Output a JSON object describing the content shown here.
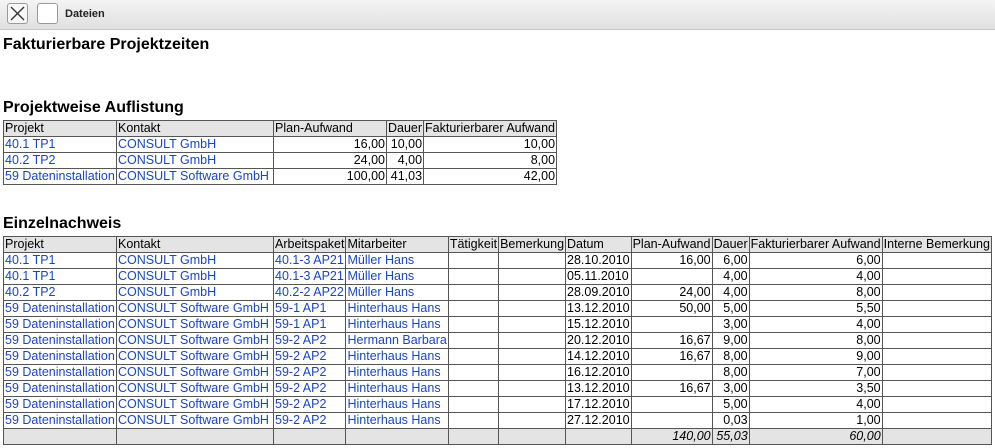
{
  "toolbar": {
    "close_icon": "close-icon",
    "title": "Dateien"
  },
  "page": {
    "title": "Fakturierbare Projektzeiten"
  },
  "projects": {
    "heading": "Projektweise Auflistung",
    "columns": [
      "Projekt",
      "Kontakt",
      "Plan-Aufwand",
      "Dauer",
      "Fakturierbarer Aufwand"
    ],
    "rows": [
      [
        "40.1 TP1",
        "CONSULT GmbH",
        "16,00",
        "10,00",
        "10,00"
      ],
      [
        "40.2 TP2",
        "CONSULT GmbH",
        "24,00",
        "4,00",
        "8,00"
      ],
      [
        "59 Dateninstallation",
        "CONSULT Software GmbH",
        "100,00",
        "41,03",
        "42,00"
      ]
    ]
  },
  "details": {
    "heading": "Einzelnachweis",
    "columns": [
      "Projekt",
      "Kontakt",
      "Arbeitspaket",
      "Mitarbeiter",
      "Tätigkeit",
      "Bemerkung",
      "Datum",
      "Plan-Aufwand",
      "Dauer",
      "Fakturierbarer Aufwand",
      "Interne Bemerkung"
    ],
    "rows": [
      [
        "40.1 TP1",
        "CONSULT GmbH",
        "40.1-3 AP21",
        "Müller Hans",
        "",
        "",
        "28.10.2010",
        "16,00",
        "6,00",
        "6,00",
        ""
      ],
      [
        "40.1 TP1",
        "CONSULT GmbH",
        "40.1-3 AP21",
        "Müller Hans",
        "",
        "",
        "05.11.2010",
        "",
        "4,00",
        "4,00",
        ""
      ],
      [
        "40.2 TP2",
        "CONSULT GmbH",
        "40.2-2 AP22",
        "Müller Hans",
        "",
        "",
        "28.09.2010",
        "24,00",
        "4,00",
        "8,00",
        ""
      ],
      [
        "59 Dateninstallation",
        "CONSULT Software GmbH",
        "59-1 AP1",
        "Hinterhaus Hans",
        "",
        "",
        "13.12.2010",
        "50,00",
        "5,00",
        "5,50",
        ""
      ],
      [
        "59 Dateninstallation",
        "CONSULT Software GmbH",
        "59-1 AP1",
        "Hinterhaus Hans",
        "",
        "",
        "15.12.2010",
        "",
        "3,00",
        "4,00",
        ""
      ],
      [
        "59 Dateninstallation",
        "CONSULT Software GmbH",
        "59-2 AP2",
        "Hermann Barbara",
        "",
        "",
        "20.12.2010",
        "16,67",
        "9,00",
        "8,00",
        ""
      ],
      [
        "59 Dateninstallation",
        "CONSULT Software GmbH",
        "59-2 AP2",
        "Hinterhaus Hans",
        "",
        "",
        "14.12.2010",
        "16,67",
        "8,00",
        "9,00",
        ""
      ],
      [
        "59 Dateninstallation",
        "CONSULT Software GmbH",
        "59-2 AP2",
        "Hinterhaus Hans",
        "",
        "",
        "16.12.2010",
        "",
        "8,00",
        "7,00",
        ""
      ],
      [
        "59 Dateninstallation",
        "CONSULT Software GmbH",
        "59-2 AP2",
        "Hinterhaus Hans",
        "",
        "",
        "13.12.2010",
        "16,67",
        "3,00",
        "3,50",
        ""
      ],
      [
        "59 Dateninstallation",
        "CONSULT Software GmbH",
        "59-2 AP2",
        "Hinterhaus Hans",
        "",
        "",
        "17.12.2010",
        "",
        "5,00",
        "4,00",
        ""
      ],
      [
        "59 Dateninstallation",
        "CONSULT Software GmbH",
        "59-2 AP2",
        "Hinterhaus Hans",
        "",
        "",
        "27.12.2010",
        "",
        "0,03",
        "1,00",
        ""
      ]
    ],
    "totals": [
      "",
      "",
      "",
      "",
      "",
      "",
      "",
      "140,00",
      "55,03",
      "60,00",
      ""
    ]
  },
  "colors": {
    "link": "#1a44c8",
    "header_bg": "#e4e4e4",
    "border": "#555555"
  }
}
